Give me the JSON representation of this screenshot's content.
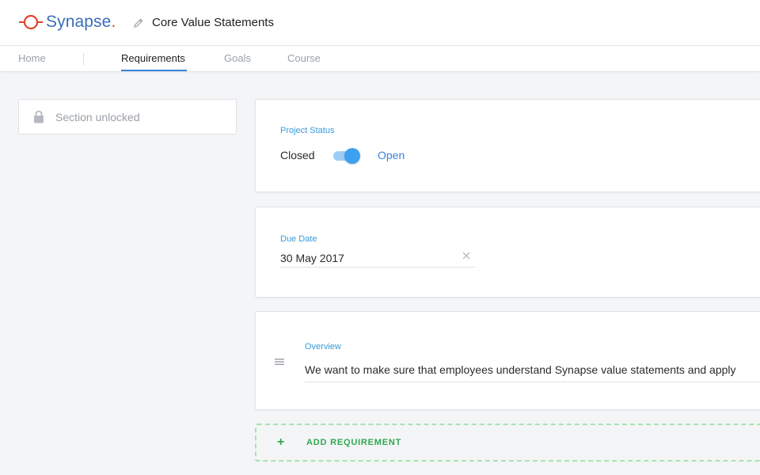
{
  "app": {
    "logo_text": "Synapse",
    "logo_dot": ".",
    "page_title": "Core Value Statements"
  },
  "tabs": [
    {
      "label": "Home",
      "active": false
    },
    {
      "label": "Requirements",
      "active": true
    },
    {
      "label": "Goals",
      "active": false
    },
    {
      "label": "Course",
      "active": false
    }
  ],
  "sidebar": {
    "section_status": "Section unlocked",
    "icon": "lock-icon"
  },
  "project_status": {
    "label": "Project Status",
    "off_label": "Closed",
    "on_label": "Open",
    "is_open": true
  },
  "due_date": {
    "label": "Due Date",
    "value": "30 May 2017"
  },
  "overview": {
    "label": "Overview",
    "value": "We want to make sure that employees understand Synapse value statements and apply"
  },
  "add_requirement": {
    "plus": "+",
    "label": "ADD REQUIREMENT"
  },
  "colors": {
    "accent": "#3b82d6",
    "field_label": "#3b9ad9",
    "brand_red": "#e0442b",
    "brand_blue": "#3a6fb8",
    "add_green": "#2fa84f",
    "toggle_on": "#3ea1f0"
  }
}
